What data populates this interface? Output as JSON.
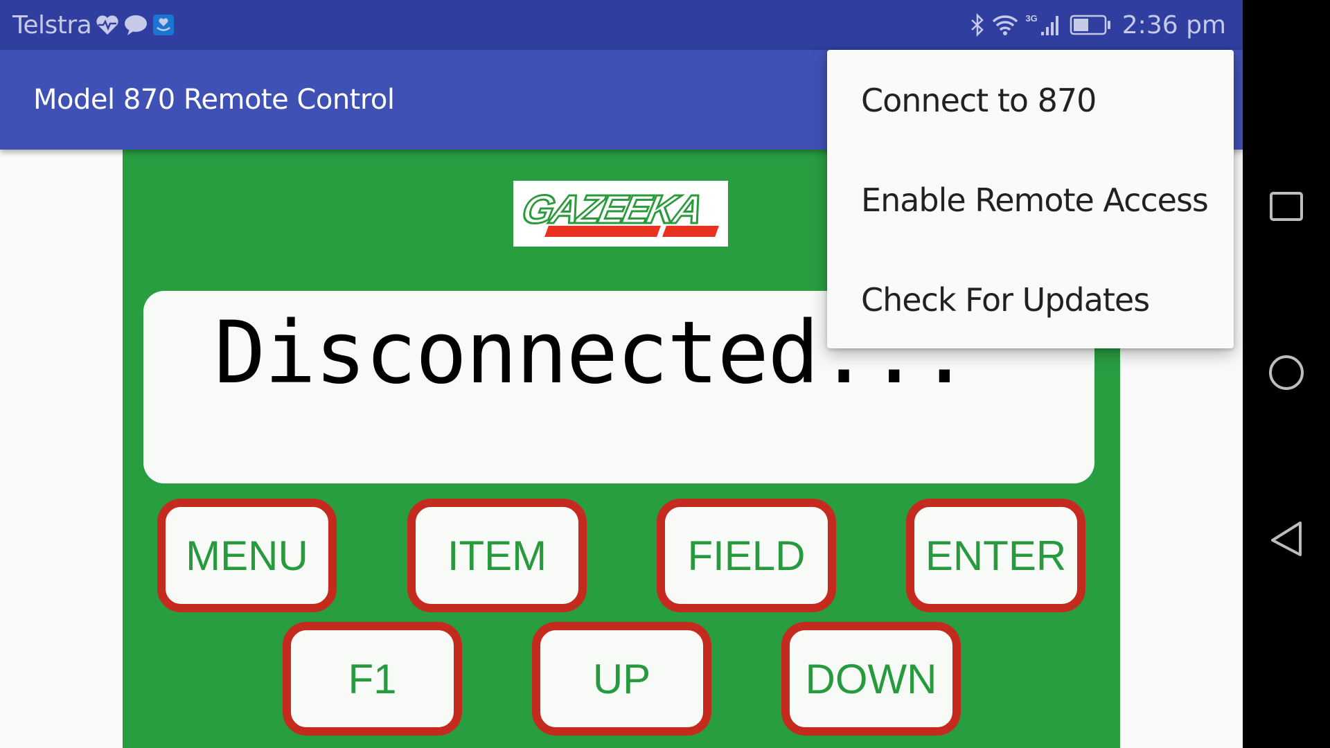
{
  "status_bar": {
    "carrier": "Telstra",
    "notification_icons": [
      "heart-rate-icon",
      "chat-bubble-icon",
      "health-app-icon"
    ],
    "system_icons": [
      "bluetooth-icon",
      "wifi-icon",
      "signal-icon",
      "battery-icon"
    ],
    "network_type": "3G",
    "battery_level_fraction": 0.5,
    "time": "2:36 pm"
  },
  "app_bar": {
    "title": "Model 870 Remote Control"
  },
  "logo": {
    "text": "GAZEEKA"
  },
  "display": {
    "text": "Disconnected..."
  },
  "keypad": {
    "row1": [
      {
        "label": "MENU"
      },
      {
        "label": "ITEM"
      },
      {
        "label": "FIELD"
      },
      {
        "label": "ENTER"
      }
    ],
    "row2": [
      {
        "label": "F1"
      },
      {
        "label": "UP"
      },
      {
        "label": "DOWN"
      }
    ]
  },
  "overflow_menu": {
    "items": [
      {
        "label": "Connect to 870"
      },
      {
        "label": "Enable Remote Access"
      },
      {
        "label": "Check For Updates"
      }
    ]
  },
  "nav_bar": {
    "buttons": [
      "recents",
      "home",
      "back"
    ]
  },
  "colors": {
    "status_bar": "#303f9f",
    "app_bar": "#3f51b5",
    "panel_green": "#299e41",
    "key_border_red": "#c42a1e",
    "key_text_green": "#279a3e",
    "logo_red": "#e8321f"
  }
}
